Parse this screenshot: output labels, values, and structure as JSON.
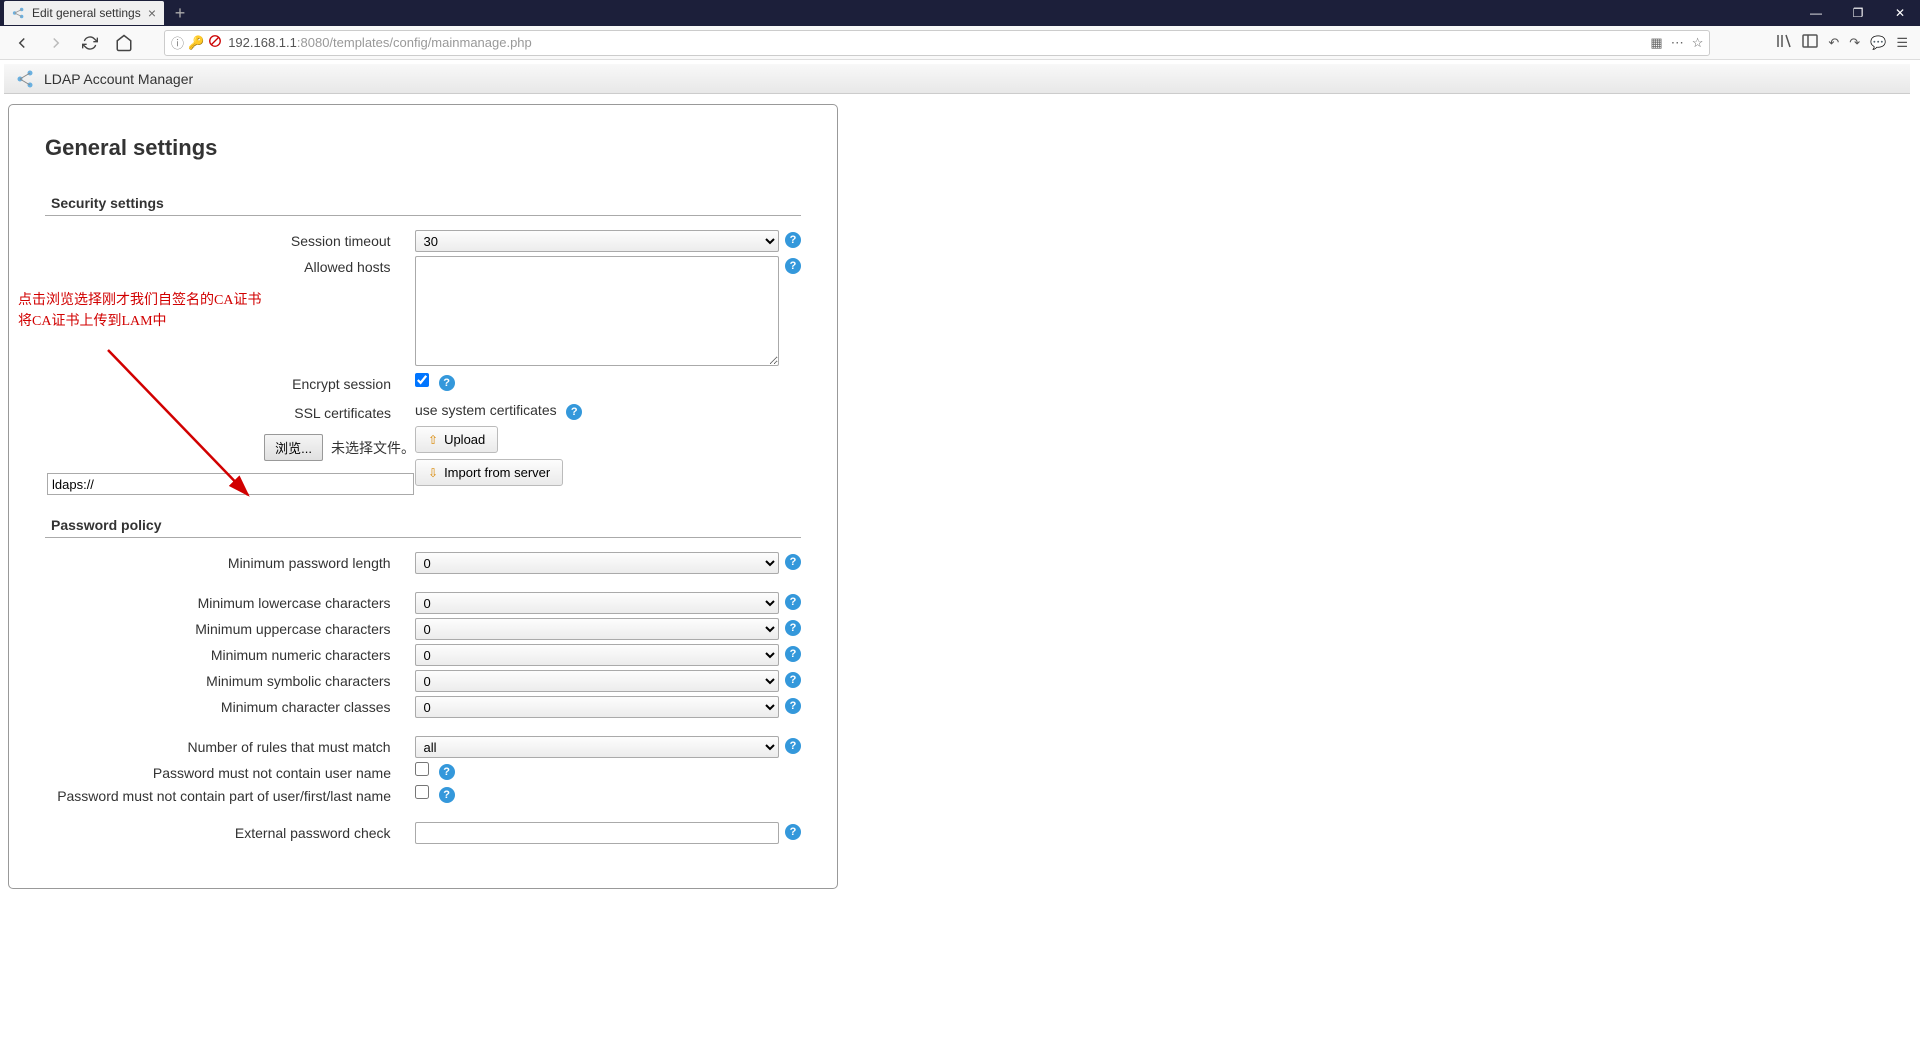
{
  "browser": {
    "tab_title": "Edit general settings",
    "url_host": "192.168.1.1",
    "url_port_path": ":8080/templates/config/mainmanage.php"
  },
  "lam_header": {
    "title": "LDAP Account Manager"
  },
  "page": {
    "title": "General settings"
  },
  "sections": {
    "security": {
      "heading": "Security settings"
    },
    "password": {
      "heading": "Password policy"
    }
  },
  "labels": {
    "session_timeout": "Session timeout",
    "allowed_hosts": "Allowed hosts",
    "encrypt_session": "Encrypt session",
    "ssl_certificates": "SSL certificates",
    "min_pwd_length": "Minimum password length",
    "min_lower": "Minimum lowercase characters",
    "min_upper": "Minimum uppercase characters",
    "min_numeric": "Minimum numeric characters",
    "min_symbolic": "Minimum symbolic characters",
    "min_classes": "Minimum character classes",
    "rules_match": "Number of rules that must match",
    "no_username": "Password must not contain user name",
    "no_partname": "Password must not contain part of user/first/last name",
    "ext_pwd_check": "External password check"
  },
  "values": {
    "session_timeout": "30",
    "allowed_hosts": "",
    "encrypt_session": true,
    "ssl_status": "use system certificates",
    "upload_btn": "Upload",
    "import_btn": "Import from server",
    "browse_btn": "浏览...",
    "no_file": "未选择文件。",
    "ldaps_url": "ldaps://",
    "min_pwd_length": "0",
    "min_lower": "0",
    "min_upper": "0",
    "min_numeric": "0",
    "min_symbolic": "0",
    "min_classes": "0",
    "rules_match": "all",
    "no_username": false,
    "no_partname": false,
    "ext_pwd_check": ""
  },
  "annotation": {
    "line1": "点击浏览选择刚才我们自签名的CA证书",
    "line2": "将CA证书上传到LAM中"
  }
}
